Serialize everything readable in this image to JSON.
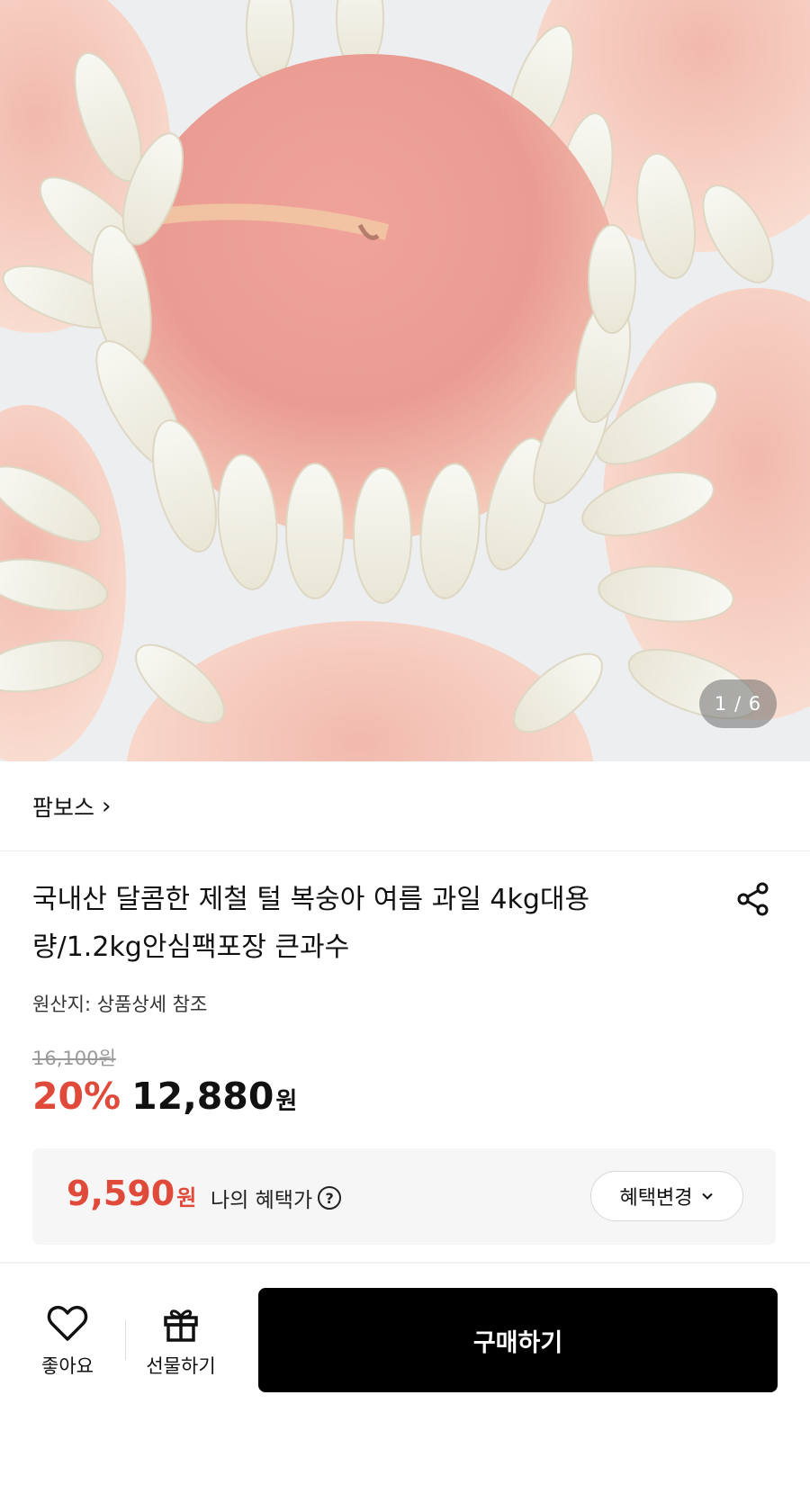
{
  "gallery": {
    "counter": "1 / 6"
  },
  "store": {
    "name": "팜보스",
    "chevron": "›"
  },
  "product": {
    "title": "국내산 달콤한 제철 털 복숭아 여름 과일 4kg대용량/1.2kg안심팩포장 큰과수",
    "origin": "원산지: 상품상세 참조",
    "original_price": "16,100원",
    "discount": "20%",
    "price": "12,880",
    "price_unit": "원"
  },
  "benefit": {
    "price": "9,590",
    "price_unit": "원",
    "label": "나의 혜택가",
    "help_glyph": "?",
    "change_button": "혜택변경"
  },
  "bottom_bar": {
    "like_label": "좋아요",
    "gift_label": "선물하기",
    "buy_label": "구매하기"
  },
  "colors": {
    "accent_red": "#e04a3a",
    "buy_button_bg": "#000000",
    "benefit_bg": "#f6f6f6"
  },
  "icons": [
    "share-icon",
    "question-icon",
    "chevron-down-icon",
    "heart-icon",
    "gift-icon"
  ]
}
